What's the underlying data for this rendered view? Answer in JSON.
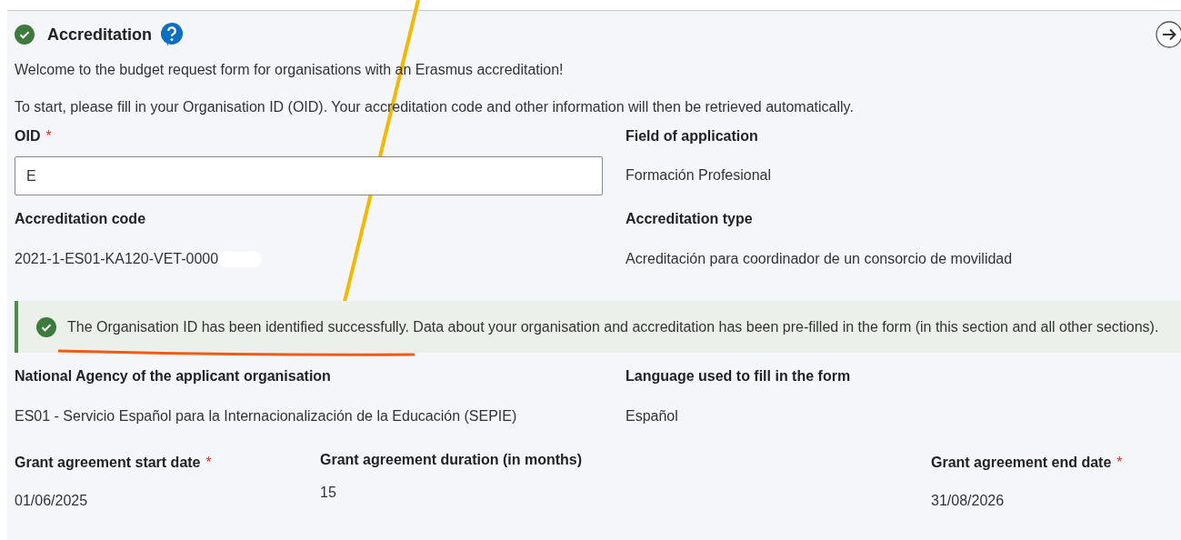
{
  "section": {
    "title": "Accreditation",
    "completed": true
  },
  "intro": [
    "Welcome to the budget request form for organisations with an Erasmus accreditation!",
    "To start, please fill in your Organisation ID (OID). Your accreditation code and other information will then be retrieved automatically."
  ],
  "top_fields": [
    {
      "label": "OID",
      "required": true,
      "kind": "input",
      "value": "E"
    },
    {
      "label": "Field of application",
      "required": false,
      "kind": "text",
      "value": "Formación Profesional"
    },
    {
      "label": "Accreditation code",
      "required": false,
      "kind": "text",
      "value": "2021-1-ES01-KA120-VET-0000"
    },
    {
      "label": "Accreditation type",
      "required": false,
      "kind": "text",
      "value": "Acreditación para coordinador de un consorcio de movilidad"
    }
  ],
  "success_message": "The Organisation ID has been identified successfully. Data about your organisation and accreditation has been pre-filled in the form (in this section and all other sections).",
  "middle_fields": [
    {
      "label": "National Agency of the applicant organisation",
      "required": false,
      "value": "ES01 - Servicio Español para la Internacionalización de la Educación (SEPIE)"
    },
    {
      "label": "Language used to fill in the form",
      "required": false,
      "value": "Español"
    }
  ],
  "date_fields": [
    {
      "label": "Grant agreement start date",
      "required": true,
      "value": "01/06/2025"
    },
    {
      "label": "Grant agreement duration (in months)",
      "required": false,
      "value": "15"
    },
    {
      "label": "Grant agreement end date",
      "required": true,
      "value": "31/08/2026"
    }
  ],
  "required_mark": "*"
}
